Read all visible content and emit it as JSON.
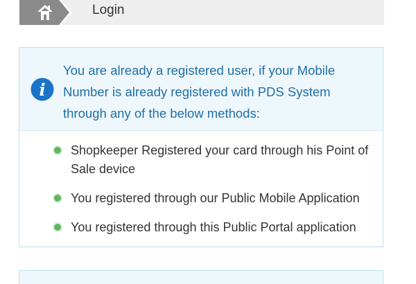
{
  "breadcrumb": {
    "home_icon": "home-icon",
    "current_label": "Login"
  },
  "info_panel": {
    "icon": "info-icon",
    "message": "You are already a registered user, if your Mobile Number is already registered with PDS System through any of the below methods:",
    "methods": [
      "Shopkeeper Registered your card through his Point of Sale device",
      "You registered through our Public Mobile Application",
      "You registered through this Public Portal application"
    ]
  },
  "colors": {
    "accent_blue": "#1e6fa8",
    "panel_bg": "#eef7fc",
    "bullet_green": "#5cb85c",
    "breadcrumb_bg": "#eeeeee",
    "home_crumb_bg": "#8a8a8a"
  }
}
